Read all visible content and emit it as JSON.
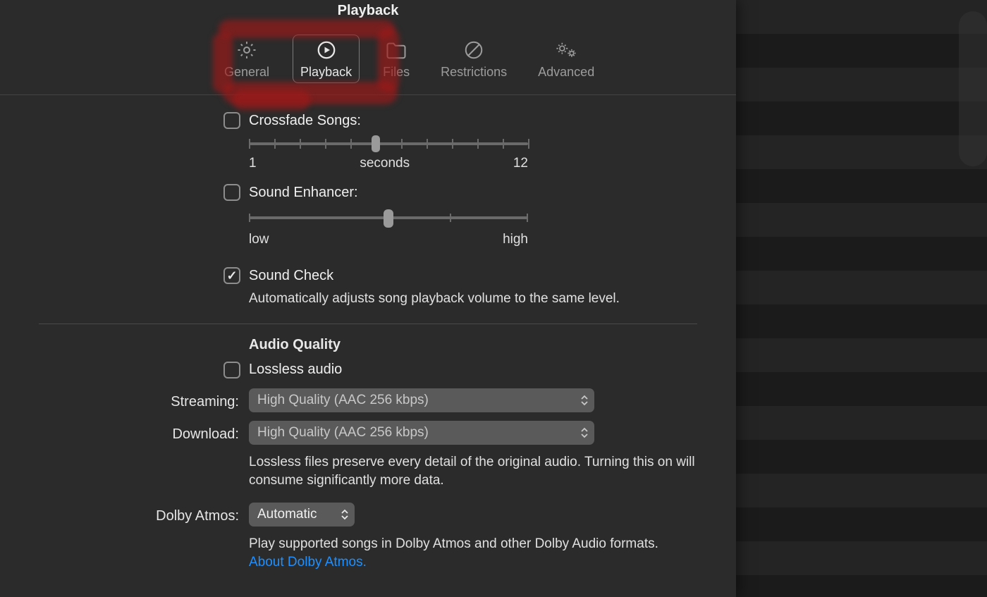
{
  "title": "Playback",
  "tabs": {
    "general": "General",
    "playback": "Playback",
    "files": "Files",
    "restrictions": "Restrictions",
    "advanced": "Advanced"
  },
  "crossfade": {
    "label": "Crossfade Songs:",
    "min": "1",
    "unit": "seconds",
    "max": "12"
  },
  "enhancer": {
    "label": "Sound Enhancer:",
    "low": "low",
    "high": "high"
  },
  "soundcheck": {
    "label": "Sound Check",
    "desc": "Automatically adjusts song playback volume to the same level."
  },
  "audioQuality": {
    "heading": "Audio Quality",
    "lossless": "Lossless audio",
    "streamingLabel": "Streaming:",
    "streamingValue": "High Quality (AAC 256 kbps)",
    "downloadLabel": "Download:",
    "downloadValue": "High Quality (AAC 256 kbps)",
    "losslessNote": "Lossless files preserve every detail of the original audio. Turning this on will consume significantly more data.",
    "dolbyLabel": "Dolby Atmos:",
    "dolbyValue": "Automatic",
    "dolbyNote": "Play supported songs in Dolby Atmos and other Dolby Audio formats.",
    "dolbyLink": "About Dolby Atmos."
  }
}
